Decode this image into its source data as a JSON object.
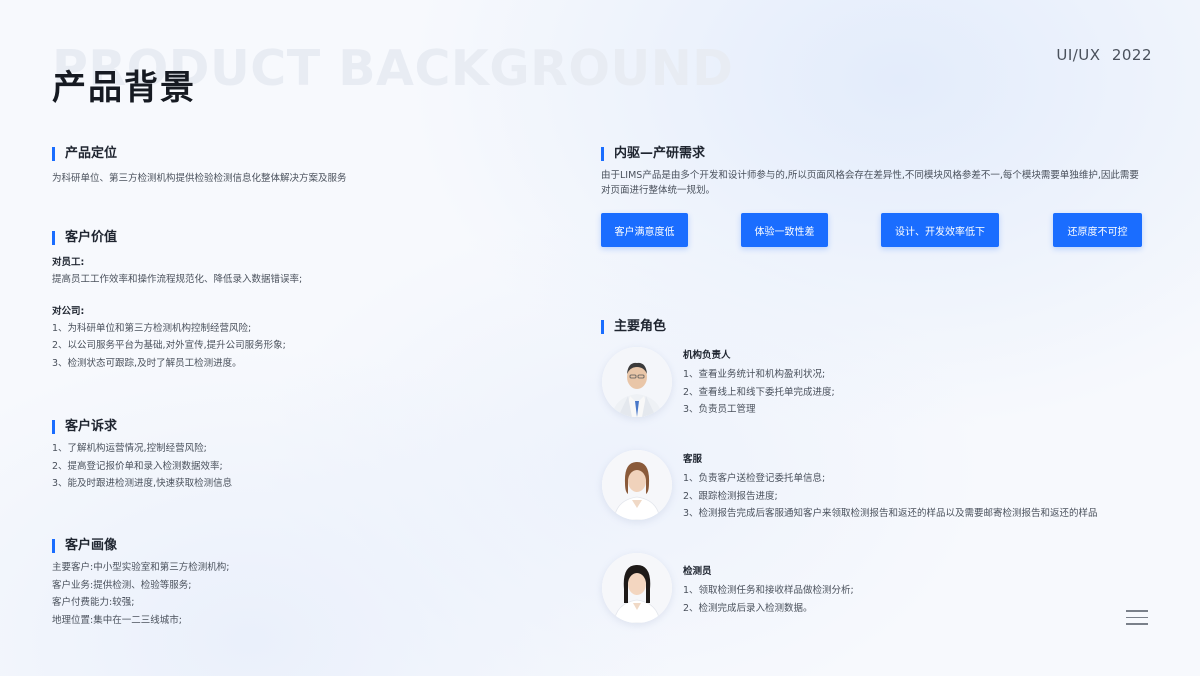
{
  "header": {
    "watermark": "PRODUCT BACKGROUND",
    "title": "产品背景",
    "year_tag": "UI/UX 2022"
  },
  "left": {
    "positioning": {
      "title": "产品定位",
      "text": "为科研单位、第三方检测机构提供检验检测信息化整体解决方案及服务"
    },
    "value": {
      "title": "客户价值",
      "employee_label": "对员工:",
      "employee_text": "提高员工工作效率和操作流程规范化、降低录入数据错误率;",
      "company_label": "对公司:",
      "company_items": [
        "1、为科研单位和第三方检测机构控制经营风险;",
        "2、以公司服务平台为基础,对外宣传,提升公司服务形象;",
        "3、检测状态可跟踪,及时了解员工检测进度。"
      ]
    },
    "demands": {
      "title": "客户诉求",
      "items": [
        "1、了解机构运营情况,控制经营风险;",
        "2、提高登记报价单和录入检测数据效率;",
        "3、能及时跟进检测进度,快速获取检测信息"
      ]
    },
    "persona": {
      "title": "客户画像",
      "items": [
        "主要客户:中小型实验室和第三方检测机构;",
        "客户业务:提供检测、检验等服务;",
        "客户付费能力:较强;",
        "地理位置:集中在一二三线城市;"
      ]
    }
  },
  "right": {
    "drive": {
      "title": "内驱—产研需求",
      "text": "由于LIMS产品是由多个开发和设计师参与的,所以页面风格会存在差异性,不同模块风格参差不一,每个模块需要单独维护,因此需要对页面进行整体统一规划。",
      "buttons": [
        "客户满意度低",
        "体验一致性差",
        "设计、开发效率低下",
        "还原度不可控"
      ]
    },
    "roles": {
      "title": "主要角色",
      "list": [
        {
          "name": "机构负责人",
          "items": [
            "1、查看业务统计和机构盈利状况;",
            "2、查看线上和线下委托单完成进度;",
            "3、负责员工管理"
          ]
        },
        {
          "name": "客服",
          "items": [
            "1、负责客户送检登记委托单信息;",
            "2、跟踪检测报告进度;",
            "3、检测报告完成后客服通知客户来领取检测报告和返还的样品以及需要邮寄检测报告和返还的样品"
          ]
        },
        {
          "name": "检测员",
          "items": [
            "1、领取检测任务和接收样品做检测分析;",
            "2、检测完成后录入检测数据。"
          ]
        }
      ]
    }
  },
  "colors": {
    "accent": "#1a6dff",
    "title": "#161a22",
    "text": "#4a515c"
  },
  "icons": {
    "menu": "menu-icon",
    "avatar": "person-avatar-icon"
  }
}
